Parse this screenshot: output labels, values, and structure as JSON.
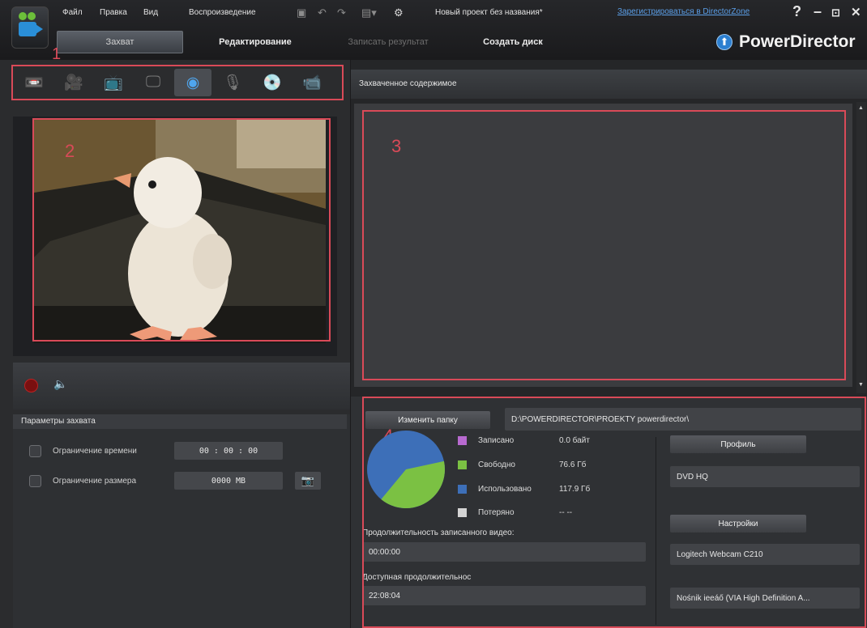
{
  "menu": {
    "items": [
      "Файл",
      "Правка",
      "Вид",
      "Воспроизведение"
    ],
    "project_title": "Новый проект без названия*",
    "register_link": "Зарегистрироваться в DirectorZone",
    "help": "?",
    "minimize": "–",
    "restore": "⊡",
    "close": "✕"
  },
  "modes": {
    "capture": "Захват",
    "edit": "Редактирование",
    "burn_result": "Записать результат",
    "create_disc": "Создать диск"
  },
  "brand": {
    "name": "PowerDirector",
    "icon": "upgrade-arrow-icon"
  },
  "annotations": {
    "one": "1",
    "two": "2",
    "three": "3",
    "four": "4"
  },
  "sources": [
    {
      "name": "dv-camcorder-icon",
      "glyph": "📼"
    },
    {
      "name": "hdv-camcorder-icon",
      "glyph": "🎥"
    },
    {
      "name": "tv-icon",
      "glyph": "📺"
    },
    {
      "name": "digital-tv-icon",
      "glyph": "🖵"
    },
    {
      "name": "webcam-icon",
      "glyph": "◉"
    },
    {
      "name": "microphone-icon",
      "glyph": "🎙"
    },
    {
      "name": "cd-icon",
      "glyph": "💿"
    },
    {
      "name": "screen-capture-icon",
      "glyph": "📹"
    }
  ],
  "active_source": 4,
  "capture_params": {
    "title": "Параметры захвата",
    "time_limit_label": "Ограничение времени",
    "time_limit_value": "00 : 00 : 00",
    "size_limit_label": "Ограничение размера",
    "size_limit_value": "0000    MB"
  },
  "captured": {
    "header": "Захваченное содержимое"
  },
  "storage": {
    "change_folder": "Изменить папку",
    "folder_path": "D:\\POWERDIRECTOR\\PROEKTY powerdirector\\",
    "legend": [
      {
        "label": "Записано",
        "value": "0.0  байт",
        "color": "#b86ad0"
      },
      {
        "label": "Свободно",
        "value": "76.6  Гб",
        "color": "#7bc143"
      },
      {
        "label": "Использовано",
        "value": "117.9  Гб",
        "color": "#3d6fb8"
      },
      {
        "label": "Потеряно",
        "value": "-- --",
        "color": "#d4d4d4"
      }
    ],
    "free_gb": 76.6,
    "used_gb": 117.9,
    "recorded_duration_label": "Продолжительность записанного видео:",
    "recorded_duration": "00:00:00",
    "available_duration_label": "Доступная продолжительнос",
    "available_duration": "22:08:04"
  },
  "profile": {
    "profile_button": "Профиль",
    "profile_value": "DVD HQ",
    "settings_button": "Настройки",
    "video_device": "Logitech Webcam C210",
    "audio_device": "Nośnik ieeáő (VIA High Definition A..."
  },
  "colors": {
    "highlight": "#d94a58",
    "accent": "#2c7fd0",
    "link": "#5b9fe8"
  }
}
